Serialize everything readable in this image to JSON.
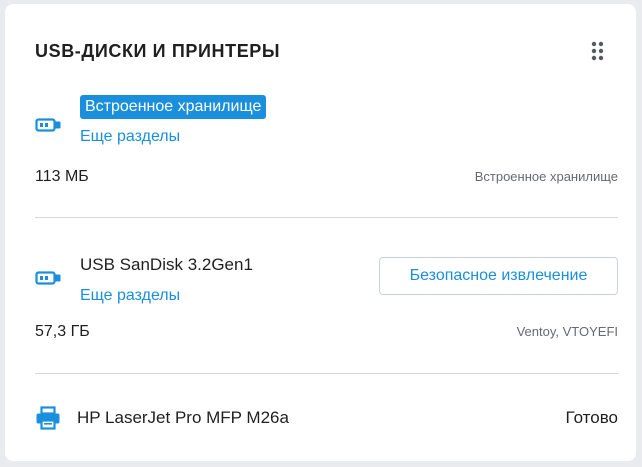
{
  "card": {
    "title": "USB-ДИСКИ И ПРИНТЕРЫ",
    "menu_icon": "drag-handle-icon"
  },
  "devices": [
    {
      "icon": "usb-drive-icon",
      "name": "Встроенное хранилище",
      "name_highlighted": true,
      "more_link": "Еще разделы",
      "size": "113 МБ",
      "meta": "Встроенное хранилище"
    },
    {
      "icon": "usb-drive-icon",
      "name": "USB SanDisk 3.2Gen1",
      "more_link": "Еще разделы",
      "eject_label": "Безопасное извлечение",
      "size": "57,3 ГБ",
      "meta": "Ventoy, VTOYEFI"
    }
  ],
  "printer": {
    "icon": "printer-icon",
    "name": "HP LaserJet Pro MFP M26a",
    "status": "Готово"
  },
  "colors": {
    "accent": "#1a8fdc",
    "background": "#e9ebee",
    "card": "#ffffff",
    "divider": "#d4d6d9",
    "muted_text": "#666a70"
  }
}
